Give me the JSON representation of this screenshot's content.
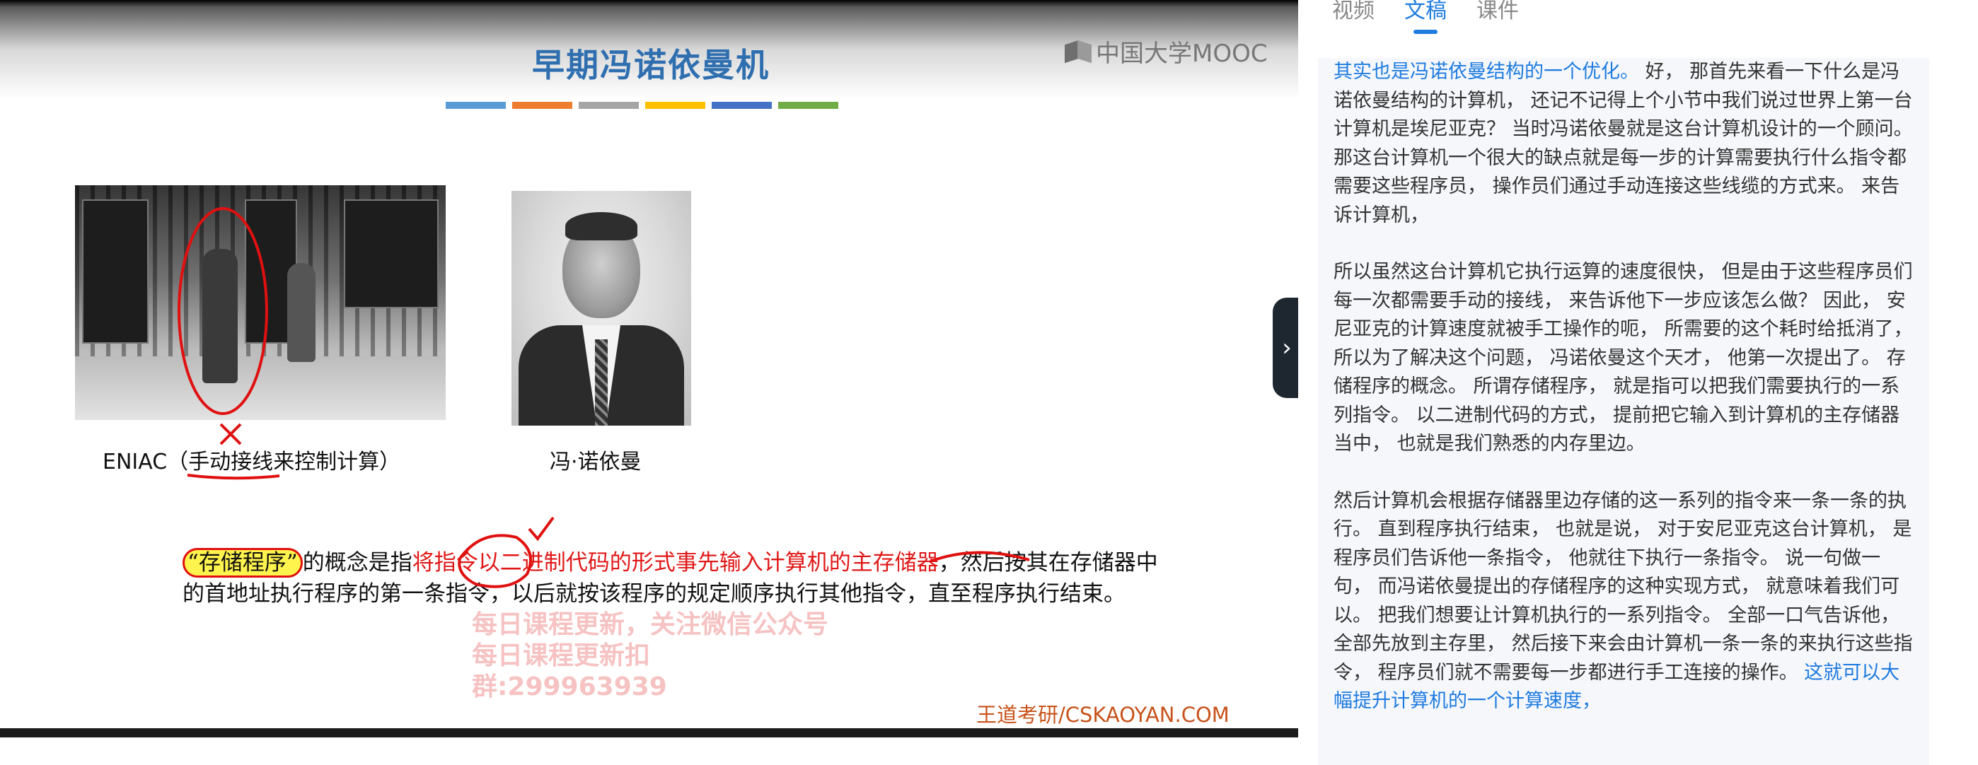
{
  "slide": {
    "title": "早期冯诺依曼机",
    "title_bar_colors": [
      "#5b9bd5",
      "#ed7d31",
      "#a5a5a5",
      "#ffc000",
      "#4472c4",
      "#70ad47"
    ],
    "logo_text": "中国大学MOOC",
    "eniac_caption_prefix": "ENIAC（",
    "eniac_caption_underlined": "手动接线",
    "eniac_caption_suffix": "来控制计算）",
    "vn_caption": "冯·诺依曼",
    "body_highlight": "“存储程序”",
    "body_text_1": "的概念是指",
    "body_red": "将指令以二进制代码的形式事先输入计算机的主存储器",
    "body_text_2": "，然后按其在存储器中的首地址执行程序的第一条指令，以后就按该程序的规定顺序执行其他指令，直至程序执行结束。",
    "watermark_line1": "每日课程更新，关注微信公众号",
    "watermark_line2": "每日课程更新扣群:299963939",
    "footer_brand": "王道考研/CSKAOYAN.COM"
  },
  "collapse_icon": "chevron-right-icon",
  "tabs": [
    "视频",
    "文稿",
    "课件"
  ],
  "active_tab": "文稿",
  "transcript": {
    "p1_blue": "其实也是冯诺依曼结构的一个优化。",
    "p1_rest": " 好， 那首先来看一下什么是冯诺依曼结构的计算机， 还记不记得上个小节中我们说过世界上第一台计算机是埃尼亚克？ 当时冯诺依曼就是这台计算机设计的一个顾问。 那这台计算机一个很大的缺点就是每一步的计算需要执行什么指令都需要这些程序员， 操作员们通过手动连接这些线缆的方式来。 来告诉计算机，",
    "p2": "所以虽然这台计算机它执行运算的速度很快， 但是由于这些程序员们每一次都需要手动的接线， 来告诉他下一步应该怎么做？ 因此， 安尼亚克的计算速度就被手工操作的呃， 所需要的这个耗时给抵消了， 所以为了解决这个问题， 冯诺依曼这个天才， 他第一次提出了。 存储程序的概念。 所谓存储程序， 就是指可以把我们需要执行的一系列指令。 以二进制代码的方式， 提前把它输入到计算机的主存储器当中， 也就是我们熟悉的内存里边。",
    "p3_rest": "然后计算机会根据存储器里边存储的这一系列的指令来一条一条的执行。 直到程序执行结束， 也就是说， 对于安尼亚克这台计算机， 是程序员们告诉他一条指令， 他就往下执行一条指令。 说一句做一句， 而冯诺依曼提出的存储程序的这种实现方式， 就意味着我们可以。 把我们想要让计算机执行的一系列指令。 全部一口气告诉他， 全部先放到主存里， 然后接下来会由计算机一条一条的来执行这些指令， 程序员们就不需要每一步都进行手工连接的操作。",
    "p3_blue": " 这就可以大幅提升计算机的一个计算速度，"
  },
  "colors": {
    "accent_blue": "#1e7be0",
    "annotation_red": "#e01010",
    "highlight_yellow": "#fff34d"
  }
}
